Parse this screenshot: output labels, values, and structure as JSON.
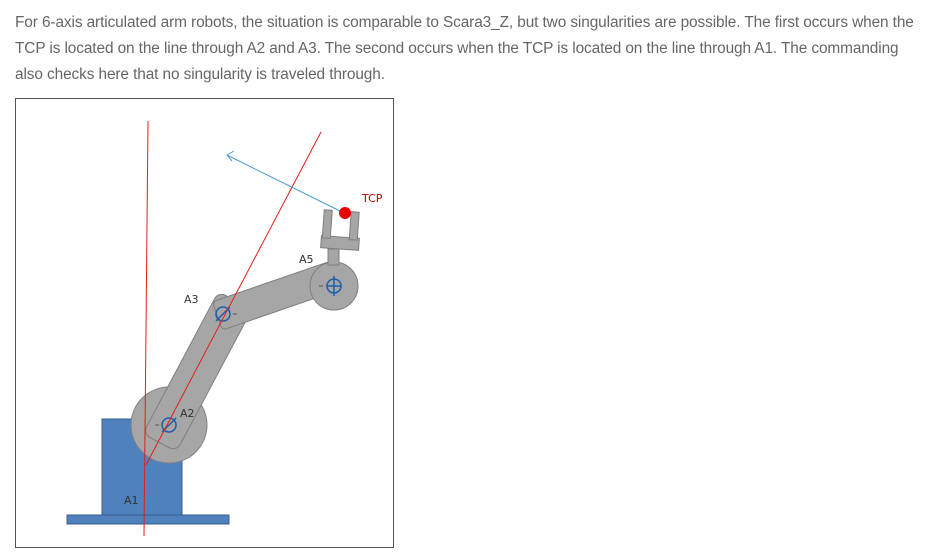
{
  "article": {
    "paragraph": "For 6-axis articulated arm robots, the situation is comparable to Scara3_Z, but two singularities are possible. The first occurs when the TCP is located on the line through A2 and A3. The second occurs when the TCP is located on the line through A1. The commanding also checks here that no singularity is traveled through."
  },
  "figure": {
    "labels": {
      "a1": "A1",
      "a2": "A2",
      "a3": "A3",
      "a5": "A5",
      "tcp": "TCP"
    },
    "colors": {
      "base": "#4f81bd",
      "base_edge": "#385d8a",
      "arm": "#a6a6a6",
      "arm_edge": "#7f7f7f",
      "singularity_line": "#e0201b",
      "direction_arrow": "#4f9bd0",
      "tcp_point": "#e60000",
      "joint": "#1f5fa8"
    }
  }
}
